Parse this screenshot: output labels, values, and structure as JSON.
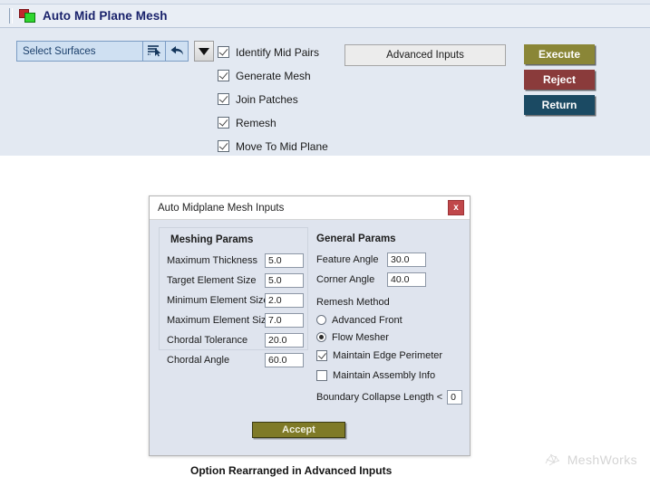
{
  "window": {
    "title": "Auto Mid Plane Mesh",
    "icon": "red-green-squares-icon"
  },
  "toolbar": {
    "select_field": {
      "value": "Select Surfaces",
      "pick_icon": "list-pick-icon",
      "undo_icon": "undo-arrow-icon"
    },
    "dropdown_icon": "chevron-down-icon",
    "advanced_inputs_label": "Advanced Inputs",
    "actions": [
      {
        "label": "Execute",
        "color": "#8a8637"
      },
      {
        "label": "Reject",
        "color": "#8a3b3b"
      },
      {
        "label": "Return",
        "color": "#1b4a63"
      }
    ]
  },
  "options": [
    {
      "label": "Identify Mid Pairs",
      "checked": true
    },
    {
      "label": "Generate Mesh",
      "checked": true
    },
    {
      "label": "Join Patches",
      "checked": true
    },
    {
      "label": "Remesh",
      "checked": true
    },
    {
      "label": "Move To Mid Plane",
      "checked": true
    }
  ],
  "dialog": {
    "title": "Auto Midplane Mesh Inputs",
    "close_label": "x",
    "close_icon": "close-icon",
    "meshing_params": {
      "title": "Meshing Params",
      "fields": [
        {
          "label": "Maximum Thickness",
          "value": "5.0"
        },
        {
          "label": "Target Element Size",
          "value": "5.0"
        },
        {
          "label": "Minimum Element Size",
          "value": "2.0"
        },
        {
          "label": "Maximum Element Size",
          "value": "7.0"
        },
        {
          "label": "Chordal Tolerance",
          "value": "20.0"
        },
        {
          "label": "Chordal Angle",
          "value": "60.0"
        }
      ]
    },
    "general_params": {
      "title": "General Params",
      "fields": [
        {
          "label": "Feature Angle",
          "value": "30.0"
        },
        {
          "label": "Corner Angle",
          "value": "40.0"
        }
      ],
      "remesh_method": {
        "title": "Remesh Method",
        "options": [
          {
            "label": "Advanced Front",
            "selected": false
          },
          {
            "label": "Flow Mesher",
            "selected": true
          }
        ]
      },
      "checkboxes": [
        {
          "label": "Maintain Edge Perimeter",
          "checked": true
        },
        {
          "label": "Maintain Assembly Info",
          "checked": false
        }
      ],
      "boundary_collapse": {
        "label": "Boundary Collapse Length <",
        "value": "0"
      }
    },
    "accept_label": "Accept"
  },
  "caption": "Option Rearranged in Advanced Inputs",
  "watermark": {
    "text": "MeshWorks",
    "icon": "meshworks-logo-icon"
  }
}
